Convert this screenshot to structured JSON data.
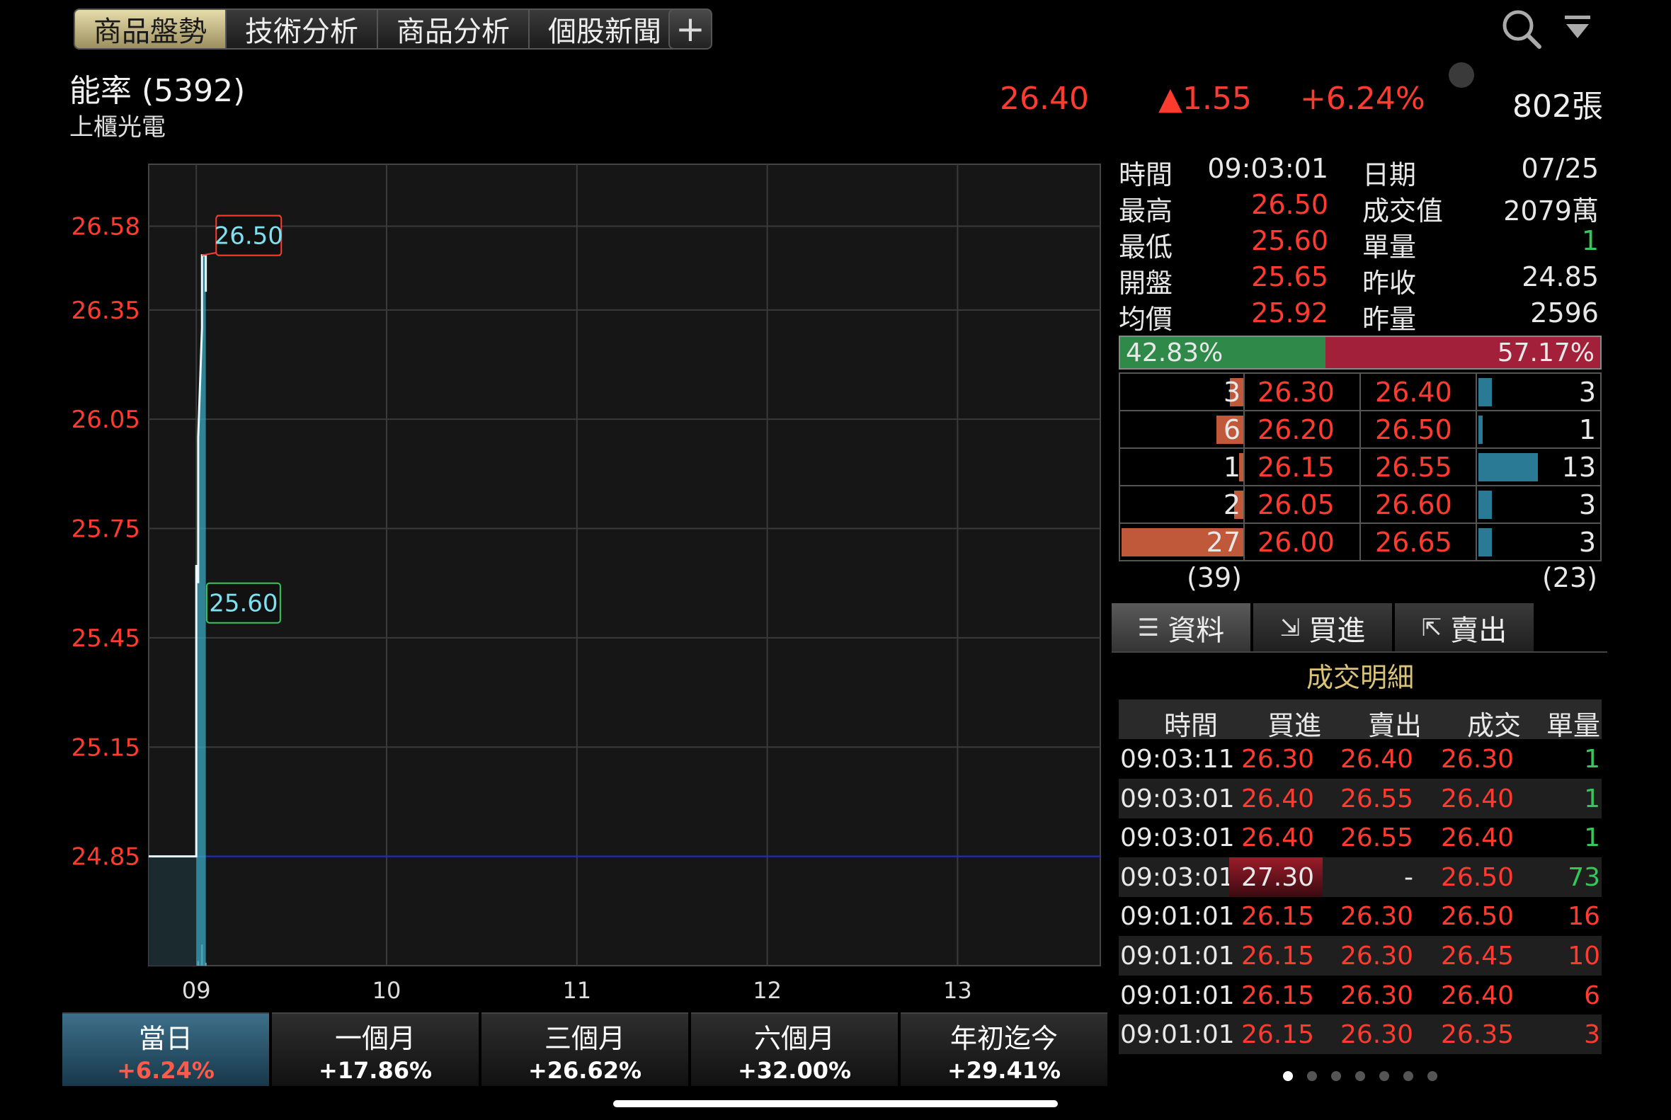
{
  "tabs": [
    {
      "label": "商品盤勢",
      "active": true
    },
    {
      "label": "技術分析",
      "active": false
    },
    {
      "label": "商品分析",
      "active": false
    },
    {
      "label": "個股新聞",
      "active": false
    }
  ],
  "add_label": "+",
  "stock": {
    "name": "能率 (5392)",
    "category": "上櫃光電",
    "price": "26.40",
    "change": "▲1.55",
    "change_pct": "+6.24%",
    "volume": "802張"
  },
  "info": [
    {
      "k1": "時間",
      "v1": "09:03:01",
      "k2": "日期",
      "v2": "07/25",
      "c1": "white",
      "c2": "white"
    },
    {
      "k1": "最高",
      "v1": "26.50",
      "k2": "成交值",
      "v2": "2079萬",
      "c1": "red",
      "c2": "white"
    },
    {
      "k1": "最低",
      "v1": "25.60",
      "k2": "單量",
      "v2": "1",
      "c1": "red",
      "c2": "green"
    },
    {
      "k1": "開盤",
      "v1": "25.65",
      "k2": "昨收",
      "v2": "24.85",
      "c1": "red",
      "c2": "white"
    },
    {
      "k1": "均價",
      "v1": "25.92",
      "k2": "昨量",
      "v2": "2596",
      "c1": "red",
      "c2": "white"
    }
  ],
  "ratio": {
    "buy": "42.83%",
    "sell": "57.17%",
    "buy_fraction": 0.4283
  },
  "book": [
    {
      "bid_qty": "3",
      "bid": "26.30",
      "ask": "26.40",
      "ask_qty": "3",
      "bid_n": 3,
      "ask_n": 3
    },
    {
      "bid_qty": "6",
      "bid": "26.20",
      "ask": "26.50",
      "ask_qty": "1",
      "bid_n": 6,
      "ask_n": 1
    },
    {
      "bid_qty": "1",
      "bid": "26.15",
      "ask": "26.55",
      "ask_qty": "13",
      "bid_n": 1,
      "ask_n": 13
    },
    {
      "bid_qty": "2",
      "bid": "26.05",
      "ask": "26.60",
      "ask_qty": "3",
      "bid_n": 2,
      "ask_n": 3
    },
    {
      "bid_qty": "27",
      "bid": "26.00",
      "ask": "26.65",
      "ask_qty": "3",
      "bid_n": 27,
      "ask_n": 3
    }
  ],
  "book_totals": {
    "bid": "(39)",
    "ask": "(23)"
  },
  "detail_tabs": [
    {
      "label": "資料",
      "icon": "list-icon",
      "glyph": "☰",
      "active": true
    },
    {
      "label": "買進",
      "icon": "buy-icon",
      "glyph": "⇲",
      "active": false
    },
    {
      "label": "賣出",
      "icon": "sell-icon",
      "glyph": "⇱",
      "active": false
    }
  ],
  "detail_title": "成交明細",
  "trade_headers": {
    "time": "時間",
    "buy": "買進",
    "sell": "賣出",
    "deal": "成交",
    "vol": "單量"
  },
  "trades": [
    {
      "time": "09:03:11",
      "buy": "26.30",
      "sell": "26.40",
      "deal": "26.30",
      "vol": "1",
      "vol_color": "green"
    },
    {
      "time": "09:03:01",
      "buy": "26.40",
      "sell": "26.55",
      "deal": "26.40",
      "vol": "1",
      "vol_color": "green"
    },
    {
      "time": "09:03:01",
      "buy": "26.40",
      "sell": "26.55",
      "deal": "26.40",
      "vol": "1",
      "vol_color": "green"
    },
    {
      "time": "09:03:01",
      "buy": "27.30",
      "sell": "-",
      "deal": "26.50",
      "vol": "73",
      "vol_color": "green",
      "buy_highlight": true
    },
    {
      "time": "09:01:01",
      "buy": "26.15",
      "sell": "26.30",
      "deal": "26.50",
      "vol": "16",
      "vol_color": "red"
    },
    {
      "time": "09:01:01",
      "buy": "26.15",
      "sell": "26.30",
      "deal": "26.45",
      "vol": "10",
      "vol_color": "red"
    },
    {
      "time": "09:01:01",
      "buy": "26.15",
      "sell": "26.30",
      "deal": "26.40",
      "vol": "6",
      "vol_color": "red"
    },
    {
      "time": "09:01:01",
      "buy": "26.15",
      "sell": "26.30",
      "deal": "26.35",
      "vol": "3",
      "vol_color": "red"
    }
  ],
  "periods": [
    {
      "label": "當日",
      "value": "+6.24%",
      "active": true
    },
    {
      "label": "一個月",
      "value": "+17.86%",
      "active": false
    },
    {
      "label": "三個月",
      "value": "+26.62%",
      "active": false
    },
    {
      "label": "六個月",
      "value": "+32.00%",
      "active": false
    },
    {
      "label": "年初迄今",
      "value": "+29.41%",
      "active": false
    }
  ],
  "page_dots": {
    "count": 7,
    "active": 0
  },
  "colors": {
    "up": "#ff3b30",
    "down": "#34c759",
    "line": "#7fe0f0",
    "ref": "#1a2ad8"
  },
  "chart_data": {
    "type": "line",
    "y_ticks": [
      "26.58",
      "26.35",
      "26.05",
      "25.75",
      "25.45",
      "25.15",
      "24.85"
    ],
    "y_tick_values": [
      26.58,
      26.35,
      26.05,
      25.75,
      25.45,
      25.15,
      24.85
    ],
    "x_ticks": [
      "09",
      "10",
      "11",
      "12",
      "13"
    ],
    "x_tick_values": [
      9,
      10,
      11,
      12,
      13
    ],
    "xlim": [
      8.75,
      13.75
    ],
    "ylim": [
      24.55,
      26.75
    ],
    "reference_price": 24.85,
    "high_label": "26.50",
    "low_label": "25.60",
    "high": 26.5,
    "low": 25.6,
    "series": [
      {
        "x": [
          8.75,
          9.0,
          9.0,
          9.01,
          9.01,
          9.02,
          9.03,
          9.03,
          9.05,
          9.05,
          9.05
        ],
        "y": [
          24.85,
          24.85,
          25.65,
          25.6,
          26.0,
          26.15,
          26.3,
          26.5,
          26.5,
          26.4,
          26.4
        ]
      }
    ],
    "volume": {
      "x": [
        9.01,
        9.03,
        9.05
      ],
      "v": [
        16,
        73,
        10
      ]
    },
    "grid": true
  }
}
